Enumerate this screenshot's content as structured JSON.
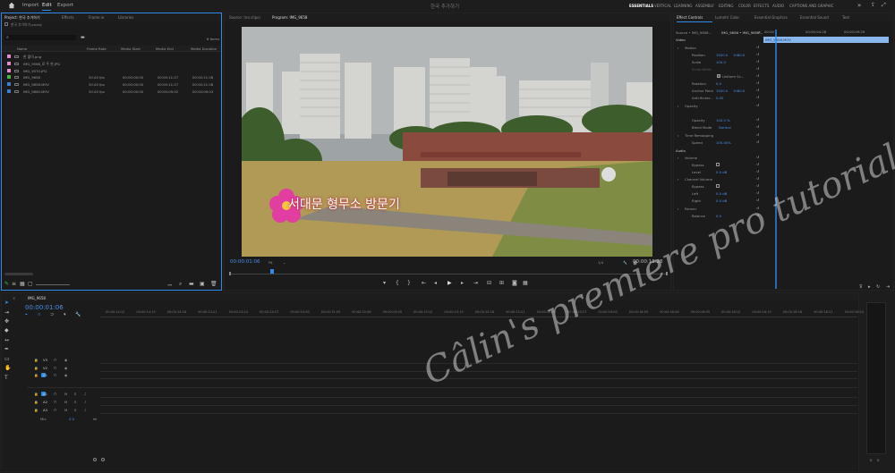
{
  "topbar": {
    "menu": [
      "Import",
      "Edit",
      "Export"
    ],
    "active_menu": "Edit",
    "project_title": "한국 추가하기",
    "workspaces": [
      "ESSENTIALS",
      "VERTICAL",
      "LEARNING",
      "ASSEMBLY",
      "EDITING",
      "COLOR",
      "EFFECTS",
      "AUDIO",
      "CAPTIONS AND GRAPHIC"
    ]
  },
  "project_panel": {
    "tabs": [
      "Project: 한국 추가하기",
      "Effects",
      "Frame.io",
      "Libraries"
    ],
    "file_label": "한국 추가하기.prproj",
    "item_count": "6 items",
    "columns": [
      "Name",
      "Frame Rate",
      "Media Start",
      "Media End",
      "Media Duration"
    ],
    "rows": [
      {
        "name": "한 줄이.png",
        "rate": "",
        "start": "",
        "end": "",
        "dur": "",
        "color": "#e58ad1"
      },
      {
        "name": "IMG_9566_로 주 한.JPG",
        "rate": "",
        "start": "",
        "end": "",
        "dur": "",
        "color": "#e58ad1"
      },
      {
        "name": "IMG_9570.JPG",
        "rate": "",
        "start": "",
        "end": "",
        "dur": "",
        "color": "#e58ad1"
      },
      {
        "name": "IMG_9658",
        "rate": "30.00 fps",
        "start": "00:00:00:00",
        "end": "00:00:11:27",
        "dur": "00:00:11:28",
        "color": "#46b846"
      },
      {
        "name": "IMG_9658.MOV",
        "rate": "30.00 fps",
        "start": "00:00:00:00",
        "end": "00:00:11:27",
        "dur": "00:00:11:28",
        "color": "#3a7fd4"
      },
      {
        "name": "IMG_9660.MOV",
        "rate": "30.00 fps",
        "start": "00:00:00:00",
        "end": "00:00:09:02",
        "dur": "00:00:09:03",
        "color": "#3a7fd4"
      }
    ]
  },
  "monitor": {
    "source_tab": "Source: (no clips)",
    "program_tab": "Program: IMG_9658",
    "overlay_title": "서대문 형무소 방문기",
    "timecode": "00:00:01:06",
    "fit": "Fit",
    "quality": "1/4",
    "duration": "00:00:11:28"
  },
  "effect_controls": {
    "tabs": [
      "Effect Controls",
      "Lumetri Color",
      "Essential Graphics",
      "Essential Sound",
      "Text"
    ],
    "source_label": "Source • IMG_9658...",
    "clip_label": "IMG_9658 • IMG_9658...",
    "header_time": "00:00",
    "header_time2": "00:00:04:28",
    "header_time3": "00:00:09:29",
    "clip_bar": "IMG_9658.MOV",
    "video": "Video",
    "motion": "Motion",
    "position": "Position",
    "position_x": "1920.0",
    "position_y": "1080.0",
    "scale": "Scale",
    "scale_v": "100.0",
    "scale_width": "Scale Width",
    "uniform": "Uniform Sc...",
    "rotation": "Rotation",
    "rotation_v": "0.0",
    "anchor": "Anchor Point",
    "anchor_x": "1920.0",
    "anchor_y": "1080.0",
    "antiflicker": "Anti-flicker...",
    "antiflicker_v": "0.00",
    "opacity": "Opacity",
    "opacity_label": "Opacity",
    "opacity_v": "100.0 %",
    "blend": "Blend Mode",
    "blend_v": "Normal",
    "remap": "Time Remapping",
    "speed": "Speed",
    "speed_v": "100.00%",
    "audio": "Audio",
    "volume": "Volume",
    "bypass": "Bypass",
    "level": "Level",
    "level_v": "0.0 dB",
    "chvol": "Channel Volume",
    "bypass2": "Bypass",
    "left": "Left",
    "left_v": "0.0 dB",
    "right": "Right",
    "right_v": "0.0 dB",
    "panner": "Panner",
    "balance": "Balance",
    "balance_v": "0.0"
  },
  "timeline": {
    "tab": "IMG_9658",
    "timecode": "00:00:01:06",
    "ruler": [
      "00:00:14:12",
      "00:00:14:15",
      "00:00:14:18",
      "00:00:14:21",
      "00:00:14:24",
      "00:00:14:27",
      "00:00:15:00",
      "00:00:15:03",
      "00:00:15:06",
      "00:00:15:09",
      "00:00:15:12",
      "00:00:15:15",
      "00:00:15:18",
      "00:00:15:21",
      "00:00:15:24",
      "00:00:15:27",
      "00:00:16:00",
      "00:00:16:03",
      "00:00:16:06",
      "00:00:16:09",
      "00:00:16:12",
      "00:00:16:15",
      "00:00:16:18",
      "00:00:16:21",
      "00:00:16:24"
    ],
    "tracks": [
      "V3",
      "V2",
      "V1",
      "A1",
      "A2",
      "A3"
    ],
    "mix": "Mix",
    "mix_v": "0.0",
    "meter": [
      "S",
      "S"
    ]
  },
  "watermark": {
    "line1": "Câlin's premiere pro tutorial",
    "line2": "Câlin's premiere pro tutorial"
  },
  "colors": {
    "accent": "#2d8ceb",
    "value": "#4b8fe6"
  }
}
